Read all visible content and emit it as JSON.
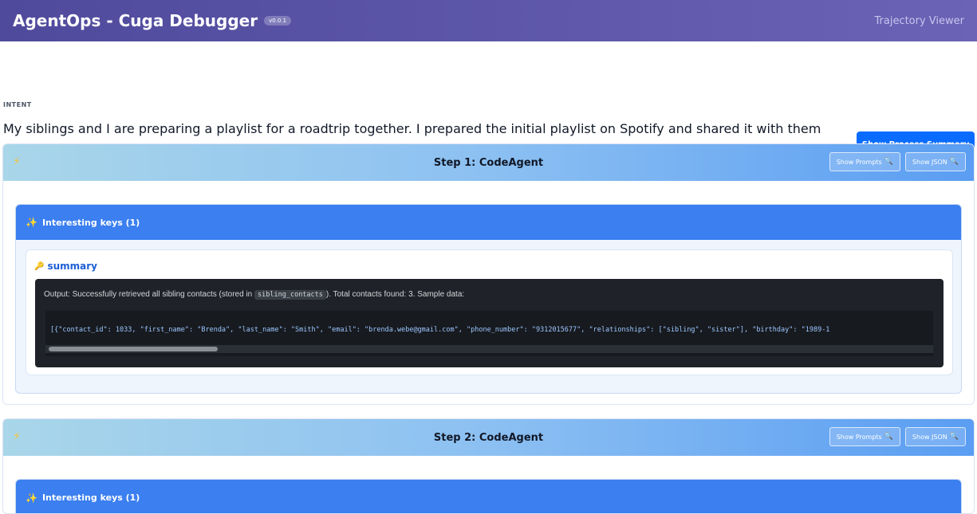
{
  "app": {
    "title": "AgentOps - Cuga Debugger",
    "version": "v0.0.1",
    "viewer_label": "Trajectory Viewer"
  },
  "intent": {
    "label": "INTENT",
    "text": "My siblings and I are preparing a playlist for a roadtrip together. I prepared the initial playlist on Spotify and shared it with them on phone messages. They have replied with suggested changes. Please update this playlist accordingly.",
    "summary_button": "Show Process Summary"
  },
  "steps": [
    {
      "title": "Step 1: CodeAgent",
      "show_prompts": "Show Prompts",
      "show_json": "Show JSON",
      "keys_title": "Interesting keys (1)",
      "key_name": "summary",
      "output_prefix": "Output: Successfully retrieved all sibling contacts (stored in ",
      "output_code": "sibling_contacts",
      "output_suffix": "). Total contacts found: 3. Sample data:",
      "json_text": "[{\"contact_id\": 1033, \"first_name\": \"Brenda\", \"last_name\": \"Smith\", \"email\": \"brenda.webe@gmail.com\", \"phone_number\": \"9312015677\", \"relationships\": [\"sibling\", \"sister\"], \"birthday\": \"1989-1"
    },
    {
      "title": "Step 2: CodeAgent",
      "show_prompts": "Show Prompts",
      "show_json": "Show JSON",
      "keys_title": "Interesting keys (1)"
    }
  ],
  "icons": {
    "bolt": "lightning-icon",
    "sparkle": "sparkle-icon",
    "key": "key-icon",
    "magnifier": "magnifier-icon"
  },
  "colors": {
    "topbar": "#4f4a9c",
    "primary_button": "#0a6cff",
    "keys_header": "#3b7ff0",
    "code_bg": "#1f2329"
  }
}
